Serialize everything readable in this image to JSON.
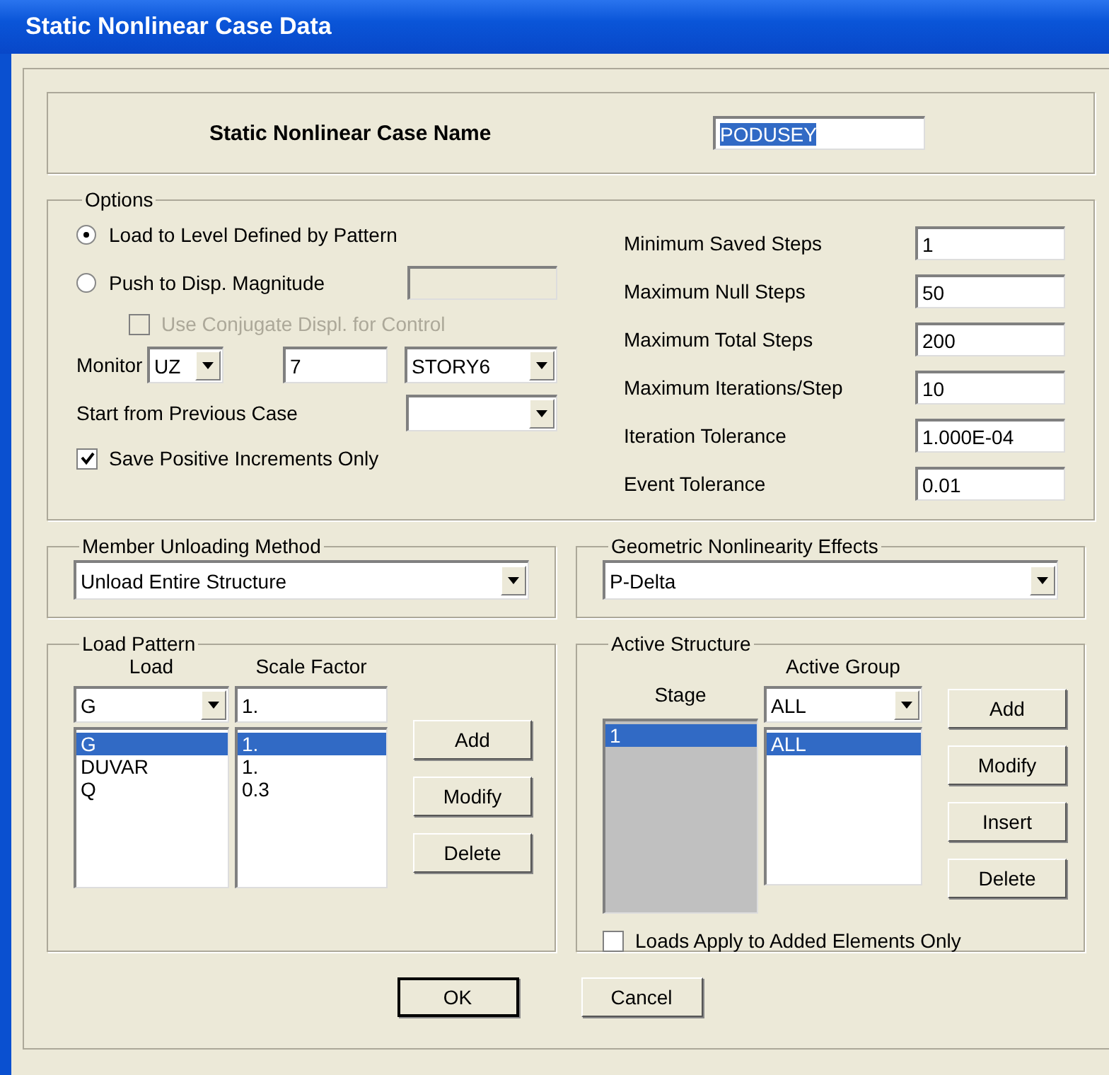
{
  "window": {
    "title": "Static Nonlinear Case  Data"
  },
  "case_name": {
    "label": "Static Nonlinear Case  Name",
    "value": "PODUSEY",
    "text_selected": true
  },
  "options": {
    "title": "Options",
    "load_modes": [
      {
        "label": "Load to Level Defined by Pattern",
        "selected": true
      },
      {
        "label": "Push to Disp. Magnitude",
        "selected": false
      }
    ],
    "magnitude_field": {
      "disabled": true
    },
    "conjugate": {
      "label": "Use Conjugate Displ. for Control",
      "checked": false,
      "disabled": true
    },
    "monitor": {
      "label": "Monitor",
      "dof": "UZ",
      "point": "7",
      "story": "STORY6"
    },
    "start_from": {
      "label": "Start from Previous Case"
    },
    "save_positive": {
      "label": "Save Positive Increments Only",
      "checked": true
    },
    "params": [
      {
        "label": "Minimum Saved Steps",
        "value": "1"
      },
      {
        "label": "Maximum Null Steps",
        "value": "50"
      },
      {
        "label": "Maximum Total Steps",
        "value": "200"
      },
      {
        "label": "Maximum Iterations/Step",
        "value": "10"
      },
      {
        "label": "Iteration Tolerance",
        "value": "1.000E-04"
      },
      {
        "label": "Event Tolerance",
        "value": "0.01"
      }
    ]
  },
  "member_unloading": {
    "title": "Member Unloading Method",
    "value": "Unload Entire Structure"
  },
  "geometric": {
    "title": "Geometric Nonlinearity Effects",
    "value": "P-Delta"
  },
  "load_pattern": {
    "title": "Load Pattern",
    "load_header": "Load",
    "scale_header": "Scale Factor",
    "load_input": "G",
    "scale_input": "1.",
    "rows": [
      {
        "load": "G",
        "scale": "1.",
        "selected": true
      },
      {
        "load": "DUVAR",
        "scale": "1.",
        "selected": false
      },
      {
        "load": "Q",
        "scale": "0.3",
        "selected": false
      }
    ],
    "buttons": [
      "Add",
      "Modify",
      "Delete"
    ]
  },
  "active_structure": {
    "title": "Active Structure",
    "stage_header": "Stage",
    "group_header": "Active Group",
    "group_input": "ALL",
    "rows": [
      {
        "stage": "1",
        "group": "ALL",
        "selected": true
      }
    ],
    "buttons": [
      "Add",
      "Modify",
      "Insert",
      "Delete"
    ],
    "loads_apply": {
      "label": "Loads Apply to Added Elements Only",
      "checked": false
    }
  },
  "buttons": [
    {
      "label": "OK",
      "default": true
    },
    {
      "label": "Cancel",
      "default": false
    }
  ]
}
